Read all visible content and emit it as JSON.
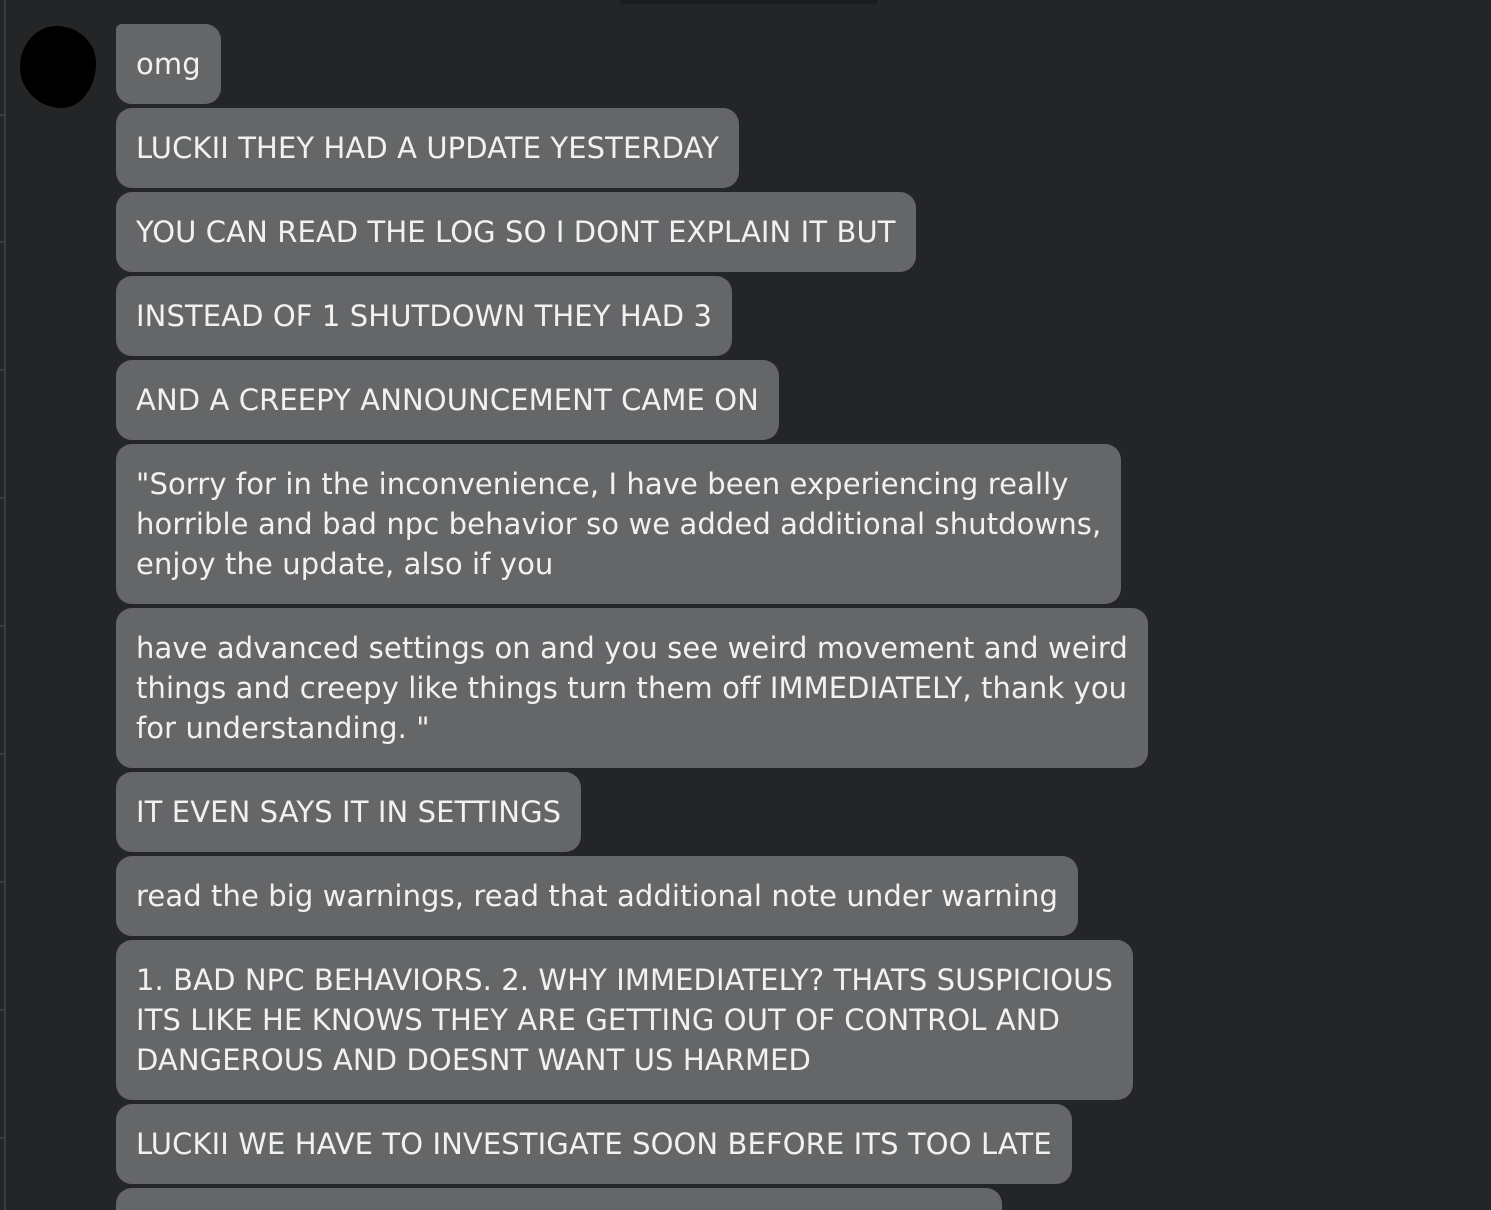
{
  "conversation": {
    "messages": [
      {
        "text": "omg"
      },
      {
        "text": "LUCKII THEY HAD A UPDATE YESTERDAY"
      },
      {
        "text": "YOU CAN READ THE LOG SO I DONT EXPLAIN IT BUT"
      },
      {
        "text": "INSTEAD OF 1 SHUTDOWN THEY HAD 3"
      },
      {
        "text": "AND A CREEPY ANNOUNCEMENT CAME ON"
      },
      {
        "text": "\"Sorry for in the inconvenience, I have been experiencing really\nhorrible and bad npc behavior so we added additional shutdowns,\nenjoy the update, also if you"
      },
      {
        "text": "have advanced settings on and you see weird movement and weird\nthings and creepy like things turn them off IMMEDIATELY, thank you\nfor understanding. \""
      },
      {
        "text": "IT EVEN SAYS IT IN SETTINGS"
      },
      {
        "text": "read the big warnings, read that additional note under warning"
      },
      {
        "text": "1. BAD NPC BEHAVIORS. 2. WHY IMMEDIATELY? THATS SUSPICIOUS\nITS LIKE HE KNOWS THEY ARE GETTING OUT OF CONTROL AND\nDANGEROUS AND DOESNT WANT US HARMED"
      },
      {
        "text": "LUCKII WE HAVE TO INVESTIGATE SOON BEFORE ITS TOO LATE"
      }
    ]
  },
  "colors": {
    "background": "#242527",
    "bubble": "#656668",
    "text": "#f1f1f1",
    "avatar": "#000000"
  }
}
